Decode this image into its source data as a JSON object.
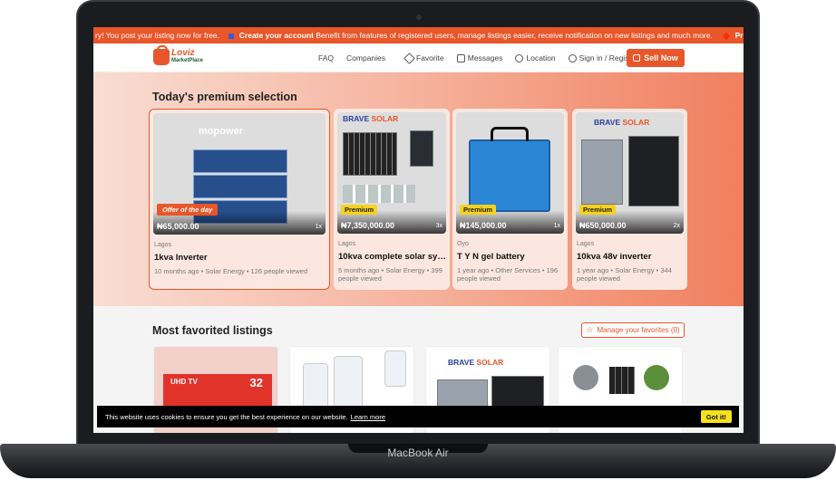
{
  "device": {
    "model_label": "MacBook Air"
  },
  "announcement": {
    "lead": "ry! You post your listing now for free.",
    "cta": "Create your account",
    "body": "Benefit from features of registered users, manage listings easier, receive notification on new listings and much more.",
    "tail": "Pro"
  },
  "nav": {
    "logo_top": "Loviz",
    "logo_bottom": "MarketPlace",
    "links": [
      "FAQ",
      "Companies",
      "Favorite",
      "Messages",
      "Location",
      "Sign in / Register"
    ],
    "sell_label": "Sell Now"
  },
  "premium": {
    "title": "Today's premium selection",
    "cards": [
      {
        "badge": "Offer of the day",
        "price": "₦65,000.00",
        "count": "1x",
        "location": "Lagos",
        "title": "1kva Inverter",
        "meta": "10 months ago • Solar Energy • 126 people viewed"
      },
      {
        "badge": "Premium",
        "price": "₦7,350,000.00",
        "count": "3x",
        "location": "Lagos",
        "title": "10kva complete solar sys...",
        "meta": "5 months ago • Solar Energy • 399 people viewed"
      },
      {
        "badge": "Premium",
        "price": "₦145,000.00",
        "count": "1x",
        "location": "Oyo",
        "title": "T Y N gel battery",
        "meta": "1 year ago • Other Services • 196 people viewed"
      },
      {
        "badge": "Premium",
        "price": "₦650,000.00",
        "count": "2x",
        "location": "Lagos",
        "title": "10kva 48v inverter",
        "meta": "1 year ago • Solar Energy • 344 people viewed"
      }
    ],
    "image_texts": {
      "mopower": "mopower",
      "brave_a": "BRAVE",
      "brave_b": "SOLAR"
    }
  },
  "favorites": {
    "title": "Most favorited listings",
    "manage_label": "Manage your favorites (0)",
    "tv_text": "UHD TV",
    "tv_size": "32"
  },
  "cookie": {
    "text": "This website uses cookies to ensure you get the best experience on our website.",
    "link": "Learn more",
    "button": "Got it!"
  }
}
